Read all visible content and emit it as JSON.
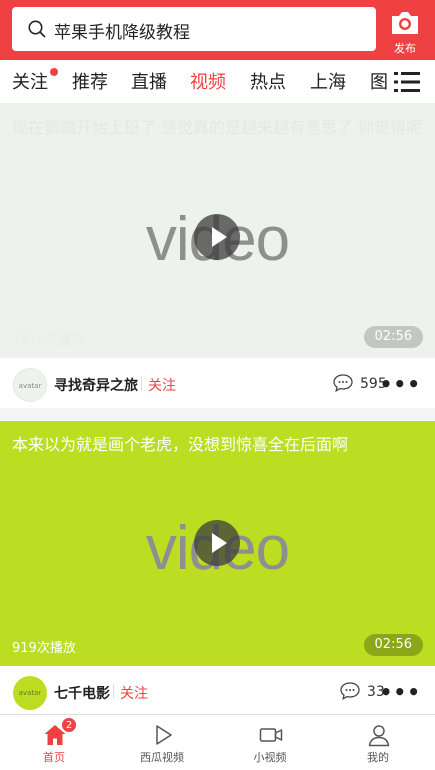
{
  "search": {
    "text": "苹果手机降级教程",
    "icon": "search-icon"
  },
  "publish": {
    "label": "发布",
    "icon": "camera-icon"
  },
  "tabs": [
    {
      "label": "关注",
      "dot": true
    },
    {
      "label": "推荐"
    },
    {
      "label": "直播"
    },
    {
      "label": "视频",
      "active": true
    },
    {
      "label": "热点"
    },
    {
      "label": "上海"
    },
    {
      "label": "图"
    }
  ],
  "menu_icon": "list-menu-icon",
  "feed": [
    {
      "title": "现在鹦鹉开始上班了 感觉真的是越来越有意思了 你觉得呢",
      "thumb_word": "video",
      "plays": "1519次播放",
      "duration": "02:56",
      "avatar_text": "avatar",
      "author": "寻找奇异之旅",
      "follow": "关注",
      "comments": "595"
    },
    {
      "title": "本来以为就是画个老虎，没想到惊喜全在后面啊",
      "thumb_word": "video",
      "plays": "919次播放",
      "duration": "02:56",
      "avatar_text": "avatar",
      "author": "七千电影",
      "follow": "关注",
      "comments": "33"
    }
  ],
  "more": "•••",
  "bottom_nav": [
    {
      "label": "首页",
      "icon": "home-icon",
      "active": true,
      "badge": "2"
    },
    {
      "label": "西瓜视频",
      "icon": "play-outline-icon"
    },
    {
      "label": "小视频",
      "icon": "video-camera-icon"
    },
    {
      "label": "我的",
      "icon": "user-icon"
    }
  ],
  "colors": {
    "brand": "#f04142",
    "card2_bg": "#bcdd22",
    "card1_bg": "#eef2ec"
  }
}
